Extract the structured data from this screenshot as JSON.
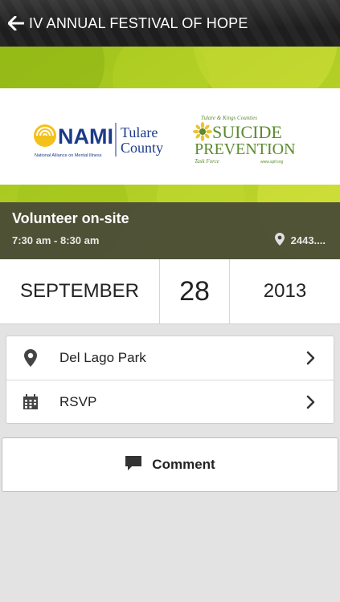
{
  "header": {
    "title": "IV ANNUAL FESTIVAL OF HOPE",
    "back_icon": "arrow-left-icon"
  },
  "hero": {
    "nami_logo": {
      "wordmark": "NAMI",
      "subtitle": "National Alliance on Mental Illness",
      "county_line1": "Tulare",
      "county_line2": "County"
    },
    "suicide_prevention_logo": {
      "top": "Tulare & Kings Counties",
      "line1": "SUICIDE",
      "line2": "PREVENTION",
      "line3": "Task Force",
      "url": "www.spif.org"
    }
  },
  "event": {
    "title": "Volunteer on-site",
    "time": "7:30 am - 8:30 am",
    "location": "2443....",
    "location_icon": "map-pin-icon"
  },
  "date": {
    "month": "SEPTEMBER",
    "day": "28",
    "year": "2013"
  },
  "details": [
    {
      "label": "Del Lago Park",
      "icon": "map-pin-icon"
    },
    {
      "label": "RSVP",
      "icon": "calendar-icon"
    }
  ],
  "comment": {
    "label": "Comment",
    "icon": "speech-bubble-icon"
  },
  "colors": {
    "topbar": "#1f1f1f",
    "hero_green": "#a9c81d",
    "event_band": "#46463a",
    "nami_blue": "#1c3a8a",
    "nami_yellow": "#f3c11b",
    "sp_green": "#5b8a2e"
  }
}
